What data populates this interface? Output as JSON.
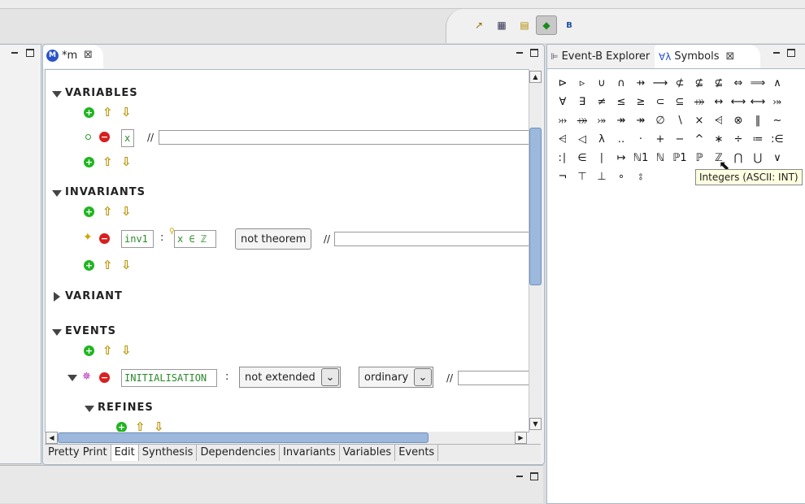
{
  "toolbar": {
    "icons": [
      "new-icon",
      "table-icon",
      "folders-icon",
      "context-active-icon",
      "eventb-icon"
    ],
    "glyphs": [
      "↗",
      "▦",
      "▤",
      "◆",
      "B"
    ]
  },
  "editor": {
    "tab_title": "*m",
    "tab_badge": "M",
    "variables": {
      "title": "VARIABLES",
      "items": [
        {
          "name": "x",
          "comment_sep": "//",
          "comment": ""
        }
      ]
    },
    "invariants": {
      "title": "INVARIANTS",
      "items": [
        {
          "label": "inv1",
          "colon": ":",
          "predicate": "x ∈ ℤ",
          "theorem": "not theorem",
          "comment_sep": "//"
        }
      ]
    },
    "variant": {
      "title": "VARIANT"
    },
    "events": {
      "title": "EVENTS",
      "items": [
        {
          "name": "INITIALISATION",
          "colon": ":",
          "extended": "not extended",
          "convergence": "ordinary",
          "comment_sep": "//"
        }
      ],
      "refines": {
        "title": "REFINES"
      }
    },
    "bottom_tabs": [
      "Pretty Print",
      "Edit",
      "Synthesis",
      "Dependencies",
      "Invariants",
      "Variables",
      "Events"
    ],
    "active_bottom_tab": "Edit"
  },
  "right_panel": {
    "tabs": [
      {
        "label": "Event-B Explorer",
        "icon": "eventb-explorer-icon"
      },
      {
        "label": "Symbols",
        "icon": "symbols-icon"
      }
    ],
    "symbols": [
      [
        "⊳",
        "▹",
        "∪",
        "∩",
        "⇸",
        "⟶",
        "⊄",
        "⊈",
        "⊈",
        "⇔",
        "⟹",
        "∧"
      ],
      [
        "∀",
        "∃",
        "≠",
        "≤",
        "≥",
        "⊂",
        "⊆",
        "⤀",
        "↔",
        "⟷",
        "⟷",
        "⤖"
      ],
      [
        "⤔",
        "⤀",
        "⤖",
        "↠",
        "↠",
        "∅",
        "∖",
        "×",
        "⩤",
        "⊗",
        "‖",
        "~"
      ],
      [
        "⩤",
        "◁",
        "λ",
        "‥",
        "·",
        "+",
        "−",
        "^",
        "∗",
        "÷",
        "≔",
        ":∈"
      ],
      [
        ":∣",
        "∈",
        "∣",
        "↦",
        "ℕ1",
        "ℕ",
        "ℙ1",
        "ℙ",
        "ℤ",
        "⋂",
        "⋃",
        "∨"
      ],
      [
        "¬",
        "⊤",
        "⊥",
        "∘",
        "⦂"
      ]
    ],
    "tooltip": "Integers (ASCII: INT)"
  }
}
